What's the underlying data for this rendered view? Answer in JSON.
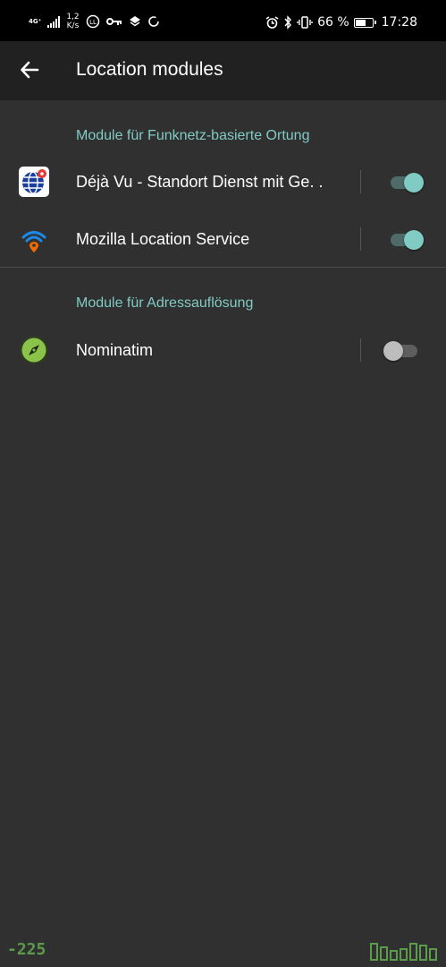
{
  "status_bar": {
    "network_type": "4G⁺",
    "speed_value": "1,2",
    "speed_unit": "K/s",
    "battery_text": "66 %",
    "battery_level": 0.66,
    "time": "17:28"
  },
  "app_bar": {
    "back_icon": "arrow-left-icon",
    "title": "Location modules"
  },
  "sections": [
    {
      "header": "Module für Funknetz-basierte Ortung",
      "items": [
        {
          "label": "Déjà Vu - Standort Dienst mit Ge. .",
          "icon": "globe-pin-icon",
          "enabled": true
        },
        {
          "label": "Mozilla Location Service",
          "icon": "wifi-pin-icon",
          "enabled": true
        }
      ]
    },
    {
      "header": "Module für Adressauflösung",
      "items": [
        {
          "label": "Nominatim",
          "icon": "compass-icon",
          "enabled": false
        }
      ]
    }
  ],
  "overlay": {
    "counter": "-225"
  },
  "colors": {
    "accent": "#80cbc4",
    "background": "#303030",
    "app_bar": "#212121",
    "overlay_green": "#5c9b4b"
  }
}
